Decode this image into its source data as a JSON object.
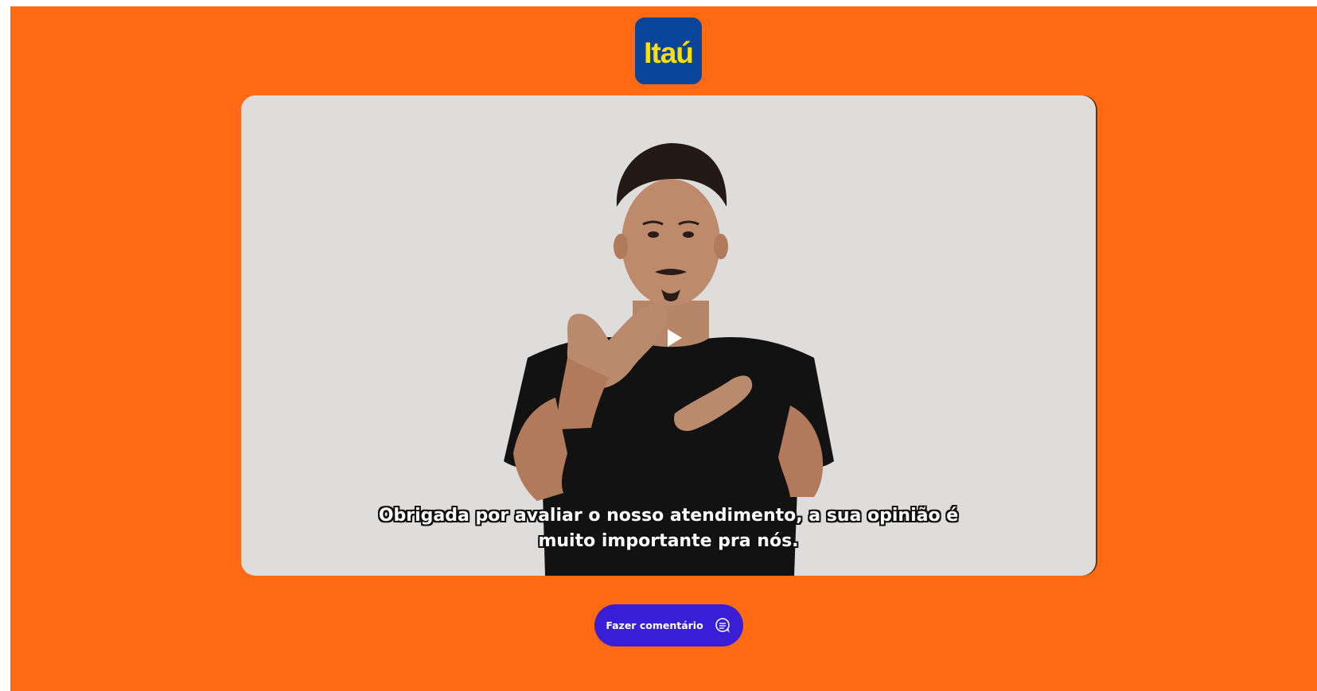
{
  "brand": {
    "logo_text": "Itaú",
    "logo_color": "#0a4599",
    "logo_text_color": "#ffe000",
    "background_color": "#ff6a13"
  },
  "video": {
    "play_icon": "play-icon",
    "captions": [
      "Obrigada por avaliar o nosso atendimento, a sua opinião é",
      "muito importante pra nós."
    ]
  },
  "actions": {
    "comment_button_label": "Fazer comentário",
    "comment_button_icon": "chat-bubble-icon",
    "comment_button_color": "#3a1ed6"
  }
}
